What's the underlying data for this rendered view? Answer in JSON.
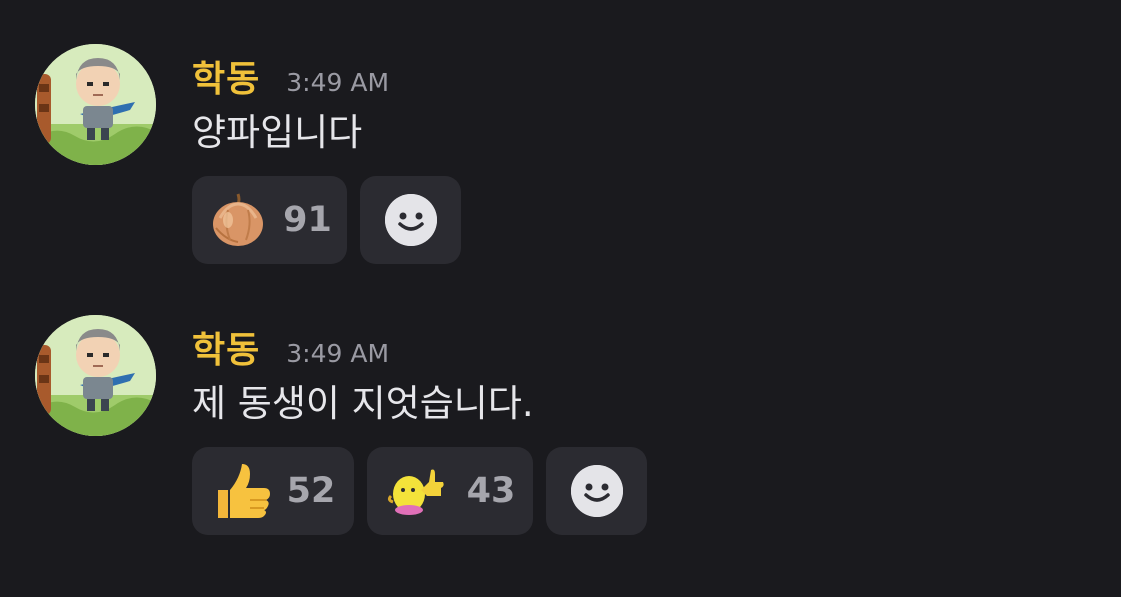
{
  "messages": [
    {
      "username": "학동",
      "timestamp": "3:49 AM",
      "text": "양파입니다",
      "reactions": [
        {
          "emoji": "onion-icon",
          "count": "91"
        }
      ]
    },
    {
      "username": "학동",
      "timestamp": "3:49 AM",
      "text": "제 동생이 지엇습니다.",
      "reactions": [
        {
          "emoji": "thumbs-up-icon",
          "count": "52"
        },
        {
          "emoji": "custom-thumbs-up-icon",
          "count": "43"
        }
      ]
    }
  ],
  "colors": {
    "background": "#1a1a1e",
    "username": "#f0c13a",
    "reaction_bg": "#2b2b31",
    "text": "#e6e6ea",
    "muted": "#9a9aa3"
  }
}
